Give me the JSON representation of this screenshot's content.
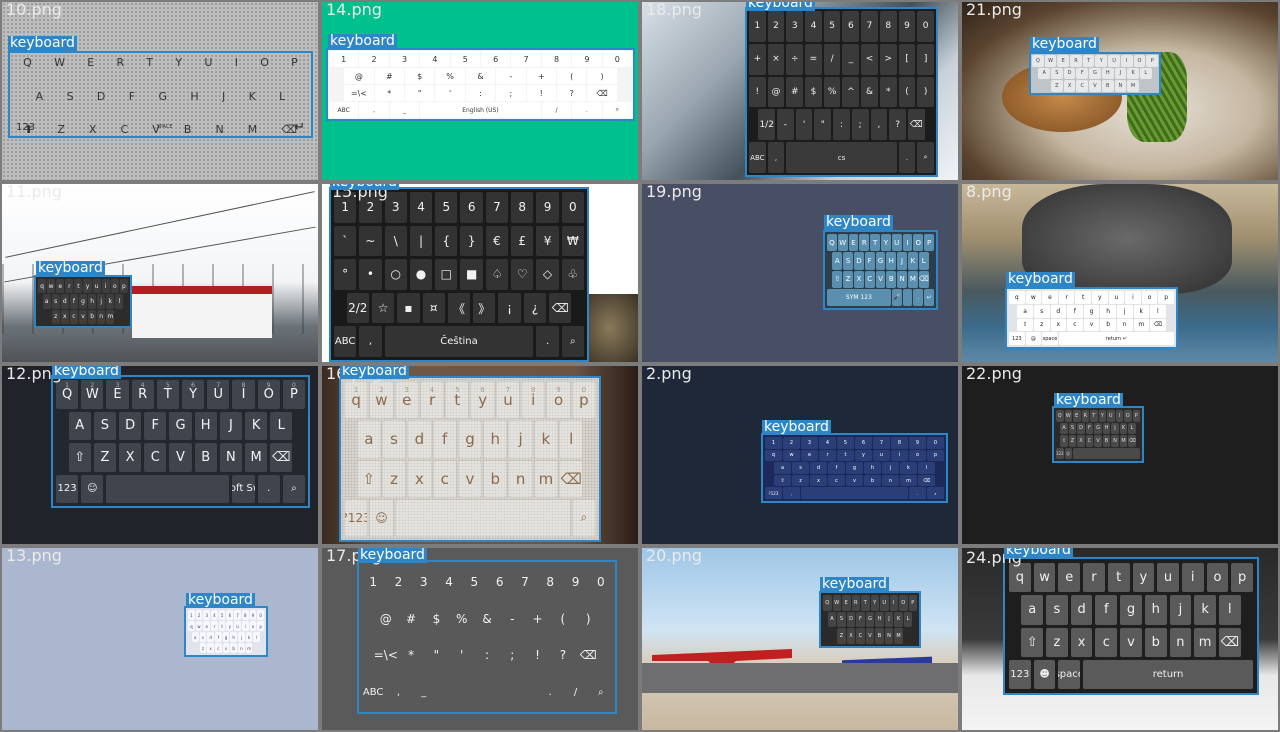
{
  "box_label": "keyboard",
  "colors": {
    "annotation": "#2f86c6",
    "page_bg": "#7c7c7c"
  },
  "tiles": {
    "t10": {
      "file": "10.png",
      "rows": [
        [
          "Q",
          "W",
          "E",
          "R",
          "T",
          "Y",
          "U",
          "I",
          "O",
          "P"
        ],
        [
          "A",
          "S",
          "D",
          "F",
          "G",
          "H",
          "J",
          "K",
          "L"
        ],
        [
          "⬆",
          "Z",
          "X",
          "C",
          "V",
          "B",
          "N",
          "M",
          "⌫"
        ]
      ],
      "bottom": [
        "123",
        "SPACE",
        "↵"
      ]
    },
    "t14": {
      "file": "14.png",
      "rows": [
        [
          "1",
          "2",
          "3",
          "4",
          "5",
          "6",
          "7",
          "8",
          "9",
          "0"
        ],
        [
          "@",
          "#",
          "$",
          "%",
          "&",
          "-",
          "+",
          "(",
          ")"
        ],
        [
          "=\\<",
          "*",
          "\"",
          "'",
          ":",
          ";",
          "!",
          "?",
          "⌫"
        ]
      ],
      "bottom": [
        "ABC",
        ",",
        "_",
        "English (US)",
        "/",
        ".",
        "⌕"
      ]
    },
    "t18": {
      "file": "18.png",
      "rows": [
        [
          "1",
          "2",
          "3",
          "4",
          "5",
          "6",
          "7",
          "8",
          "9",
          "0"
        ],
        [
          "+",
          "×",
          "÷",
          "=",
          "/",
          "_",
          "<",
          ">",
          "[",
          "]"
        ],
        [
          "!",
          "@",
          "#",
          "$",
          "%",
          "^",
          "&",
          "*",
          "(",
          ")"
        ],
        [
          "1/2",
          "-",
          "'",
          "\"",
          ":",
          ";",
          ",",
          "?",
          "⌫"
        ]
      ],
      "bottom": [
        "ABC",
        ",",
        "cs",
        ".",
        "⌕"
      ]
    },
    "t21": {
      "file": "21.png",
      "rows": [
        [
          "Q",
          "W",
          "E",
          "R",
          "T",
          "Y",
          "U",
          "I",
          "O",
          "P"
        ],
        [
          "A",
          "S",
          "D",
          "F",
          "G",
          "H",
          "J",
          "K",
          "L"
        ],
        [
          "Z",
          "X",
          "C",
          "V",
          "B",
          "N",
          "M"
        ]
      ]
    },
    "t11": {
      "file": "11.png",
      "rows": [
        [
          "q",
          "w",
          "e",
          "r",
          "t",
          "y",
          "u",
          "i",
          "o",
          "p"
        ],
        [
          "a",
          "s",
          "d",
          "f",
          "g",
          "h",
          "j",
          "k",
          "l"
        ],
        [
          "z",
          "x",
          "c",
          "v",
          "b",
          "n",
          "m"
        ]
      ]
    },
    "t15": {
      "file": "15.png",
      "rows": [
        [
          "1",
          "2",
          "3",
          "4",
          "5",
          "6",
          "7",
          "8",
          "9",
          "0"
        ],
        [
          "`",
          "~",
          "\\",
          "|",
          "{",
          "}",
          "€",
          "£",
          "¥",
          "₩"
        ],
        [
          "°",
          "•",
          "○",
          "●",
          "□",
          "■",
          "♤",
          "♡",
          "◇",
          "♧"
        ],
        [
          "2/2",
          "☆",
          "▪",
          "¤",
          "《",
          "》",
          "¡",
          "¿",
          "⌫"
        ]
      ],
      "bottom": [
        "ABC",
        ",",
        "Čeština",
        ".",
        "⌕"
      ]
    },
    "t19": {
      "file": "19.png",
      "rows": [
        [
          "Q",
          "W",
          "E",
          "R",
          "T",
          "Y",
          "U",
          "I",
          "O",
          "P"
        ],
        [
          "A",
          "S",
          "D",
          "F",
          "G",
          "H",
          "J",
          "K",
          "L"
        ],
        [
          "⇧",
          "Z",
          "X",
          "C",
          "V",
          "B",
          "N",
          "M",
          "⌫"
        ]
      ],
      "bottom": [
        "SYM 123",
        "🎤",
        "",
        ".",
        "↵"
      ]
    },
    "t8": {
      "file": "8.png",
      "rows": [
        [
          "q",
          "w",
          "e",
          "r",
          "t",
          "y",
          "u",
          "i",
          "o",
          "p"
        ],
        [
          "a",
          "s",
          "d",
          "f",
          "g",
          "h",
          "j",
          "k",
          "l"
        ],
        [
          "⇧",
          "z",
          "x",
          "c",
          "v",
          "b",
          "n",
          "m",
          "⌫"
        ]
      ],
      "bottom": [
        "123",
        "@",
        "space",
        "return ↵"
      ]
    },
    "t12": {
      "file": "12.png",
      "hints": [
        "1",
        "2",
        "3",
        "4",
        "5",
        "6",
        "7",
        "8",
        "9",
        "0"
      ],
      "rows": [
        [
          "Q",
          "W",
          "E",
          "R",
          "T",
          "Y",
          "U",
          "I",
          "O",
          "P"
        ],
        [
          "A",
          "S",
          "D",
          "F",
          "G",
          "H",
          "J",
          "K",
          "L"
        ],
        [
          "⇧",
          "Z",
          "X",
          "C",
          "V",
          "B",
          "N",
          "M",
          "⌫"
        ]
      ],
      "bottom": [
        "123",
        "☺",
        "",
        "Microsoft SwiftKey",
        ".",
        "⌕"
      ]
    },
    "t16": {
      "file": "16.png",
      "hints": [
        "1",
        "2",
        "3",
        "4",
        "5",
        "6",
        "7",
        "8",
        "9",
        "0"
      ],
      "rows": [
        [
          "q",
          "w",
          "e",
          "r",
          "t",
          "y",
          "u",
          "i",
          "o",
          "p"
        ],
        [
          "a",
          "s",
          "d",
          "f",
          "g",
          "h",
          "j",
          "k",
          "l"
        ],
        [
          "⇧",
          "z",
          "x",
          "c",
          "v",
          "b",
          "n",
          "m",
          "⌫"
        ]
      ],
      "bottom": [
        "?123",
        "☺",
        "",
        "⌕"
      ]
    },
    "t2": {
      "file": "2.png",
      "rows": [
        [
          "1",
          "2",
          "3",
          "4",
          "5",
          "6",
          "7",
          "8",
          "9",
          "0"
        ],
        [
          "q",
          "w",
          "e",
          "r",
          "t",
          "y",
          "u",
          "i",
          "o",
          "p"
        ],
        [
          "a",
          "s",
          "d",
          "f",
          "g",
          "h",
          "j",
          "k",
          "l"
        ],
        [
          "⇧",
          "z",
          "x",
          "c",
          "v",
          "b",
          "n",
          "m",
          "⌫"
        ]
      ],
      "bottom": [
        "?123",
        ",",
        "",
        ".",
        "⌕"
      ]
    },
    "t22": {
      "file": "22.png",
      "rows": [
        [
          "Q",
          "W",
          "E",
          "R",
          "T",
          "Y",
          "U",
          "I",
          "O",
          "P"
        ],
        [
          "A",
          "S",
          "D",
          "F",
          "G",
          "H",
          "J",
          "K",
          "L"
        ],
        [
          "⇧",
          "Z",
          "X",
          "C",
          "V",
          "B",
          "N",
          "M",
          "⌫"
        ]
      ],
      "bottom": [
        "123",
        "☺",
        ""
      ]
    },
    "t13": {
      "file": "13.png",
      "rows": [
        [
          "1",
          "2",
          "3",
          "4",
          "5",
          "6",
          "7",
          "8",
          "9",
          "0"
        ],
        [
          "q",
          "w",
          "e",
          "r",
          "t",
          "y",
          "u",
          "i",
          "o",
          "p"
        ],
        [
          "a",
          "s",
          "d",
          "f",
          "g",
          "h",
          "j",
          "k",
          "l"
        ],
        [
          "z",
          "x",
          "c",
          "v",
          "b",
          "n",
          "m"
        ]
      ]
    },
    "t17": {
      "file": "17.png",
      "rows": [
        [
          "1",
          "2",
          "3",
          "4",
          "5",
          "6",
          "7",
          "8",
          "9",
          "0"
        ],
        [
          "@",
          "#",
          "$",
          "%",
          "&",
          "-",
          "+",
          "(",
          ")"
        ],
        [
          "=\\<",
          "*",
          "\"",
          "'",
          ":",
          ";",
          "!",
          "?",
          "⌫"
        ]
      ],
      "bottom": [
        "ABC",
        ",",
        "_",
        "",
        ".",
        "/",
        "⌕"
      ]
    },
    "t20": {
      "file": "20.png",
      "rows": [
        [
          "Q",
          "W",
          "E",
          "R",
          "T",
          "Y",
          "U",
          "I",
          "O",
          "P"
        ],
        [
          "A",
          "S",
          "D",
          "F",
          "G",
          "H",
          "J",
          "K",
          "L"
        ],
        [
          "Z",
          "X",
          "C",
          "V",
          "B",
          "N",
          "M"
        ]
      ]
    },
    "t24": {
      "file": "24.png",
      "rows": [
        [
          "q",
          "w",
          "e",
          "r",
          "t",
          "y",
          "u",
          "i",
          "o",
          "p"
        ],
        [
          "a",
          "s",
          "d",
          "f",
          "g",
          "h",
          "j",
          "k",
          "l"
        ],
        [
          "⇧",
          "z",
          "x",
          "c",
          "v",
          "b",
          "n",
          "m",
          "⌫"
        ]
      ],
      "bottom": [
        "123",
        "☻",
        "space",
        "return"
      ]
    }
  }
}
